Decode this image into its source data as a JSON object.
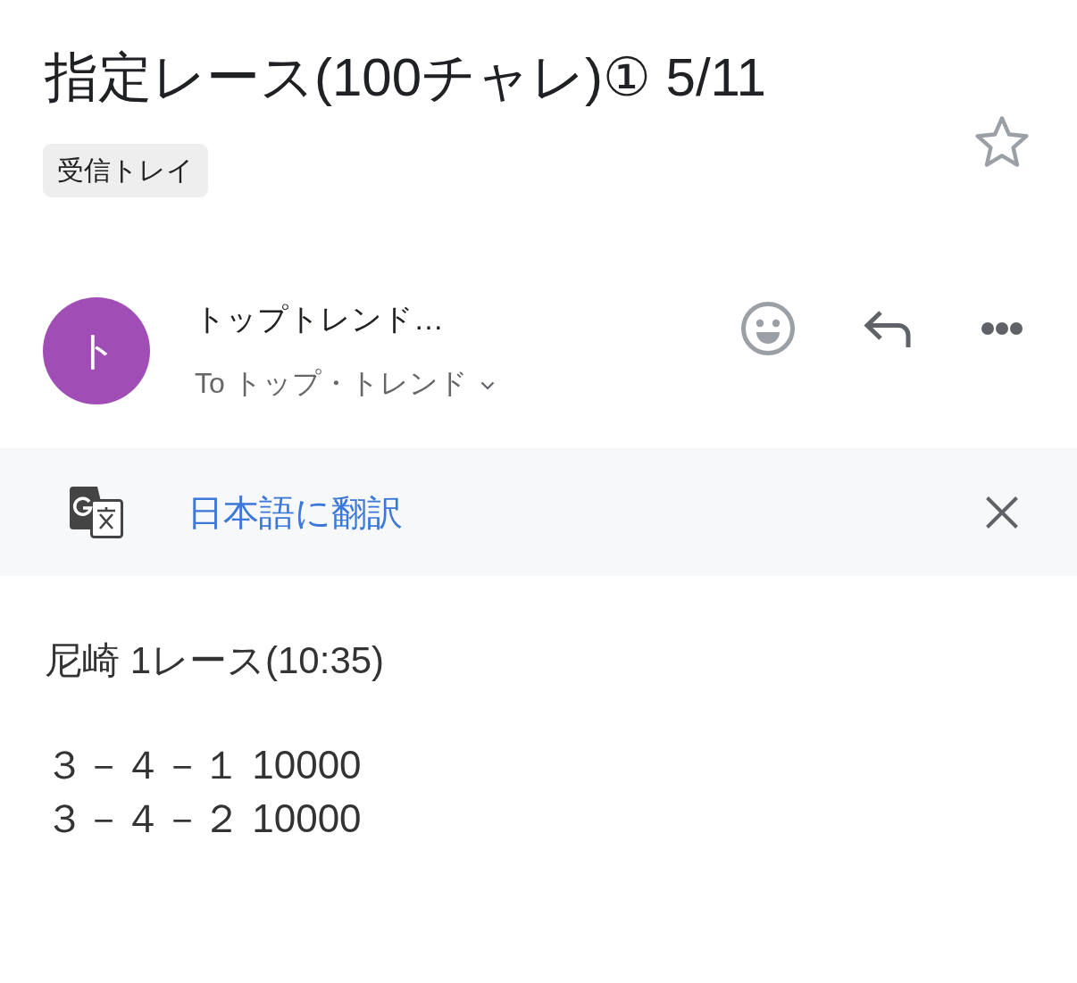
{
  "subject": {
    "title": "指定レース(100チャレ)① 5/11",
    "starred": false
  },
  "labels": [
    "受信トレイ"
  ],
  "sender": {
    "avatar_letter": "ト",
    "name": "トップトレンド…",
    "recipients": "To トップ・トレンド"
  },
  "translate_bar": {
    "link": "日本語に翻訳"
  },
  "body": {
    "paragraphs": [
      [
        "尼崎 1レース(10:35)"
      ],
      [
        "３－４－１ 10000",
        "３－４－２ 10000"
      ]
    ]
  }
}
